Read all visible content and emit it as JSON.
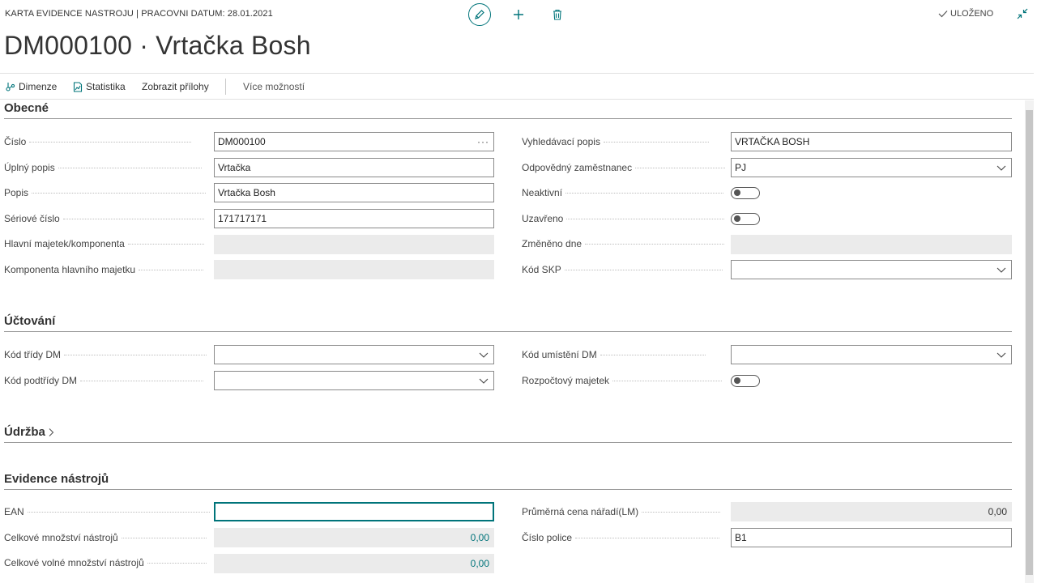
{
  "header": {
    "caption": "KARTA EVIDENCE NASTROJU | PRACOVNI DATUM: 28.01.2021",
    "saved_label": "ULOŽENO",
    "title": "DM000100 · Vrtačka Bosh"
  },
  "actions": {
    "dimensions": "Dimenze",
    "statistics": "Statistika",
    "attachments": "Zobrazit přílohy",
    "more": "Více možností"
  },
  "icons": {
    "edit": "pencil-icon",
    "add": "plus-icon",
    "delete": "trash-icon",
    "saved": "checkmark-icon",
    "collapse": "collapse-icon",
    "accent": "#00747a"
  },
  "general": {
    "title": "Obecné",
    "number_label": "Číslo",
    "number_value": "DM000100",
    "full_desc_label": "Úplný popis",
    "full_desc_value": "Vrtačka",
    "desc_label": "Popis",
    "desc_value": "Vrtačka Bosh",
    "serial_label": "Sériové číslo",
    "serial_value": "171717171",
    "main_asset_label": "Hlavní majetek/komponenta",
    "main_asset_value": "",
    "component_label": "Komponenta hlavního majetku",
    "component_value": "",
    "search_desc_label": "Vyhledávací popis",
    "search_desc_value": "VRTAČKA BOSH",
    "employee_label": "Odpovědný zaměstnanec",
    "employee_value": "PJ",
    "inactive_label": "Neaktivní",
    "inactive_value": false,
    "closed_label": "Uzavřeno",
    "closed_value": false,
    "changed_label": "Změněno dne",
    "changed_value": "",
    "skp_label": "Kód SKP",
    "skp_value": ""
  },
  "posting": {
    "title": "Účtování",
    "class_label": "Kód třídy DM",
    "class_value": "",
    "subclass_label": "Kód podtřídy DM",
    "subclass_value": "",
    "location_label": "Kód umístění DM",
    "location_value": "",
    "budget_label": "Rozpočtový majetek",
    "budget_value": false
  },
  "maintenance": {
    "title": "Údržba"
  },
  "tools": {
    "title": "Evidence nástrojů",
    "ean_label": "EAN",
    "ean_value": "",
    "total_qty_label": "Celkové množství nástrojů",
    "total_qty_value": "0,00",
    "free_qty_label": "Celkové volné množství nástrojů",
    "free_qty_value": "0,00",
    "avg_price_label": "Průměrná cena nářadí(LM)",
    "avg_price_value": "0,00",
    "shelf_label": "Číslo police",
    "shelf_value": "B1"
  }
}
